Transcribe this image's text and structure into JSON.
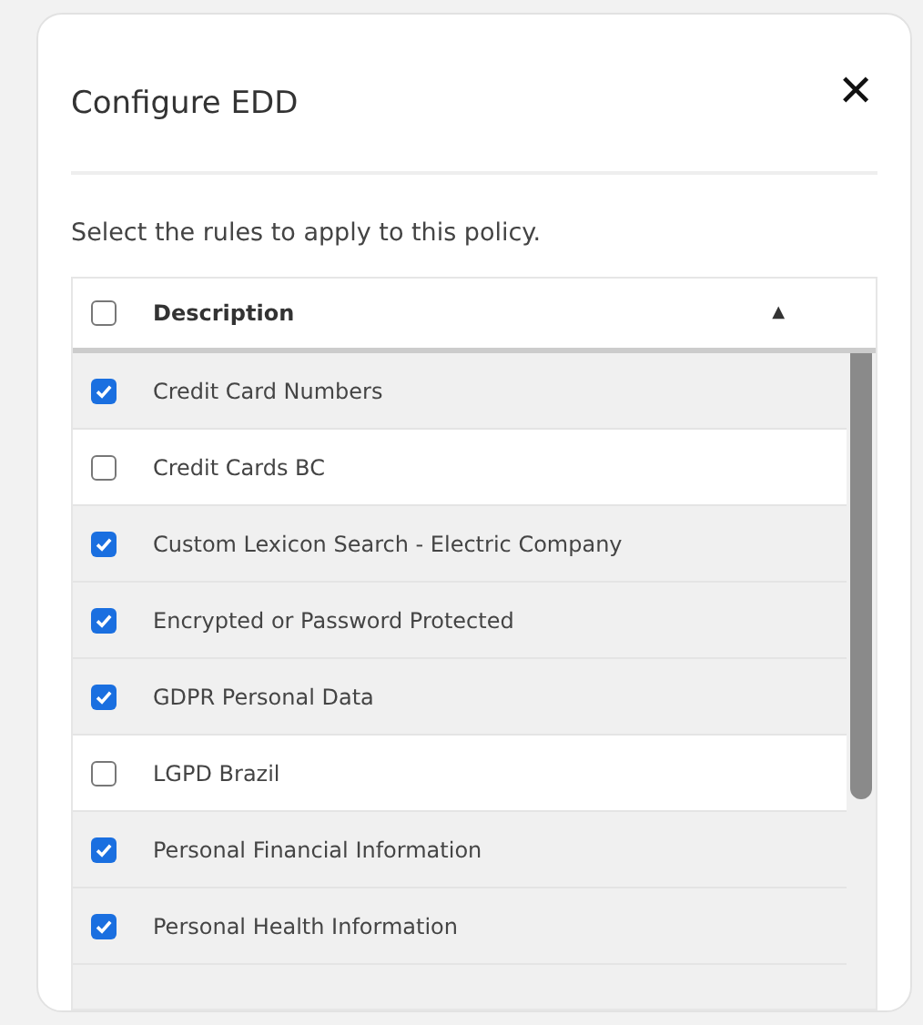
{
  "dialog": {
    "title": "Configure EDD",
    "close_icon": "✕"
  },
  "instruction": "Select the rules to apply to this policy.",
  "table": {
    "header": {
      "checked": false,
      "label": "Description",
      "sort_indicator": "▲"
    },
    "rows": [
      {
        "label": "Credit Card Numbers",
        "checked": true
      },
      {
        "label": "Credit Cards BC",
        "checked": false
      },
      {
        "label": "Custom Lexicon Search - Electric Company",
        "checked": true
      },
      {
        "label": "Encrypted or Password Protected",
        "checked": true
      },
      {
        "label": "GDPR Personal Data",
        "checked": true
      },
      {
        "label": "LGPD Brazil",
        "checked": false
      },
      {
        "label": "Personal Financial Information",
        "checked": true
      },
      {
        "label": "Personal Health Information",
        "checked": true
      }
    ]
  }
}
